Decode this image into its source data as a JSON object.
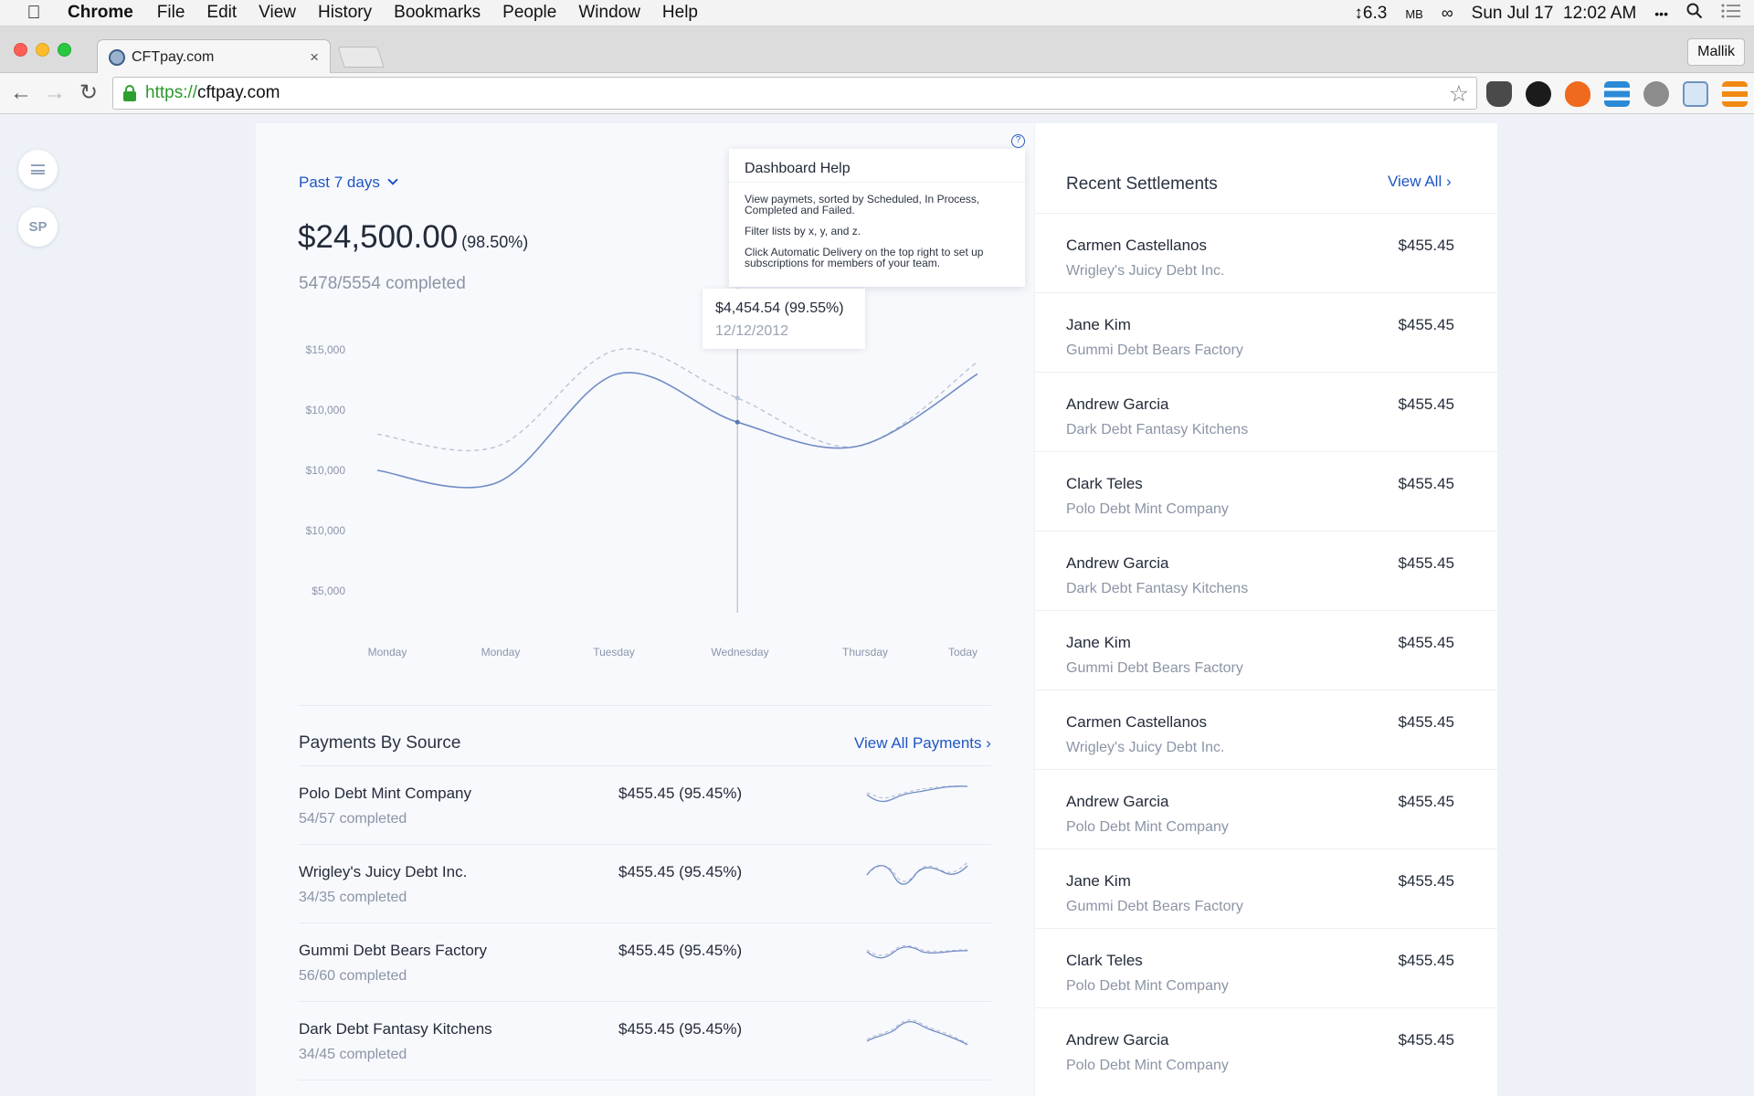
{
  "menubar": {
    "app_name": "Chrome",
    "items": [
      "File",
      "Edit",
      "View",
      "History",
      "Bookmarks",
      "People",
      "Window",
      "Help"
    ],
    "memory": "↕6.3",
    "memory_unit": "MB",
    "datetime": "Sun Jul 17  12:02 AM",
    "more": "•••"
  },
  "browser": {
    "tab_title": "CFTpay.com",
    "tab_close": "×",
    "profile": "Mallik",
    "url_scheme": "https://",
    "url_host": "cftpay.com"
  },
  "sidebar": {
    "avatar_initials": "SP"
  },
  "summary": {
    "period": "Past 7 days",
    "total": "$24,500.00",
    "total_pct": "(98.50%)",
    "completed": "5478/5554 completed"
  },
  "help": {
    "icon": "?",
    "title": "Dashboard Help",
    "lines": [
      "View paymets, sorted by Scheduled, In Process, Completed and Failed.",
      "Filter lists by x, y, and z.",
      "Click Automatic Delivery on the top right to set up subscriptions for members of your team."
    ]
  },
  "tooltip": {
    "value": "$4,454.54 (99.55%)",
    "date": "12/12/2012"
  },
  "chart_data": {
    "type": "line",
    "title": "",
    "xlabel": "",
    "ylabel": "",
    "categories": [
      "Monday",
      "Monday",
      "Tuesday",
      "Wednesday",
      "Thursday",
      "Today"
    ],
    "y_tick_labels": [
      "$15,000",
      "$10,000",
      "$10,000",
      "$10,000",
      "$5,000"
    ],
    "series": [
      {
        "style": "solid",
        "color": "#6f8cc6",
        "values": [
          10000,
          9500,
          14000,
          12000,
          11000,
          14000
        ]
      },
      {
        "style": "dashed",
        "color": "#b9c3d6",
        "values": [
          11500,
          11000,
          15000,
          13000,
          11000,
          14500
        ]
      }
    ],
    "highlight": {
      "category_index": 3,
      "value": "$4,454.54 (99.55%)",
      "date": "12/12/2012"
    },
    "grid": false,
    "legend": "none"
  },
  "payments_by_source": {
    "title": "Payments By Source",
    "link": "View All Payments ›",
    "rows": [
      {
        "name": "Polo Debt Mint Company",
        "completed": "54/57 completed",
        "amount": "$455.45 (95.45%)"
      },
      {
        "name": "Wrigley's Juicy Debt Inc.",
        "completed": "34/35 completed",
        "amount": "$455.45 (95.45%)"
      },
      {
        "name": "Gummi Debt Bears Factory",
        "completed": "56/60 completed",
        "amount": "$455.45 (95.45%)"
      },
      {
        "name": "Dark Debt Fantasy Kitchens",
        "completed": "34/45 completed",
        "amount": "$455.45 (95.45%)"
      }
    ]
  },
  "settlements": {
    "title": "Recent Settlements",
    "link": "View All ›",
    "rows": [
      {
        "name": "Carmen Castellanos",
        "company": "Wrigley's Juicy Debt Inc.",
        "amount": "$455.45"
      },
      {
        "name": "Jane Kim",
        "company": "Gummi Debt Bears Factory",
        "amount": "$455.45"
      },
      {
        "name": "Andrew Garcia",
        "company": "Dark Debt Fantasy Kitchens",
        "amount": "$455.45"
      },
      {
        "name": "Clark Teles",
        "company": "Polo Debt Mint Company",
        "amount": "$455.45"
      },
      {
        "name": "Andrew Garcia",
        "company": "Dark Debt Fantasy Kitchens",
        "amount": "$455.45"
      },
      {
        "name": "Jane Kim",
        "company": "Gummi Debt Bears Factory",
        "amount": "$455.45"
      },
      {
        "name": "Carmen Castellanos",
        "company": "Wrigley's Juicy Debt Inc.",
        "amount": "$455.45"
      },
      {
        "name": "Andrew Garcia",
        "company": "Polo Debt Mint Company",
        "amount": "$455.45"
      },
      {
        "name": "Jane Kim",
        "company": "Gummi Debt Bears Factory",
        "amount": "$455.45"
      },
      {
        "name": "Clark Teles",
        "company": "Polo Debt Mint Company",
        "amount": "$455.45"
      },
      {
        "name": "Andrew Garcia",
        "company": "Polo Debt Mint Company",
        "amount": "$455.45"
      }
    ]
  }
}
